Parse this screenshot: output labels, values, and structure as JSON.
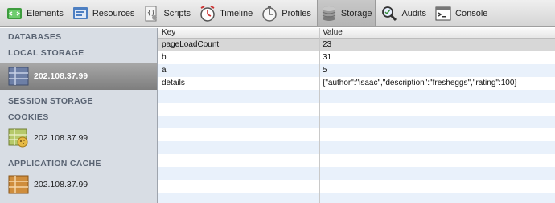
{
  "toolbar": {
    "items": [
      {
        "label": "Elements"
      },
      {
        "label": "Resources"
      },
      {
        "label": "Scripts"
      },
      {
        "label": "Timeline"
      },
      {
        "label": "Profiles"
      },
      {
        "label": "Storage"
      },
      {
        "label": "Audits"
      },
      {
        "label": "Console"
      }
    ],
    "active": "Storage"
  },
  "sidebar": {
    "databases_header": "DATABASES",
    "local_storage_header": "LOCAL STORAGE",
    "local_storage_item": "202.108.37.99",
    "session_storage_header": "SESSION STORAGE",
    "cookies_header": "COOKIES",
    "cookies_item": "202.108.37.99",
    "app_cache_header": "APPLICATION CACHE",
    "app_cache_item": "202.108.37.99"
  },
  "grid": {
    "columns": {
      "key": "Key",
      "value": "Value"
    },
    "rows": [
      {
        "key": "pageLoadCount",
        "value": "23"
      },
      {
        "key": "b",
        "value": "31"
      },
      {
        "key": "a",
        "value": "5"
      },
      {
        "key": "details",
        "value": "{\"author\":\"isaac\",\"description\":\"fresheggs\",\"rating\":100}"
      }
    ]
  },
  "colors": {
    "sidebar_bg": "#d8dde4",
    "selected_item": "#8d8d8d",
    "stripe": "#e9f1fb"
  }
}
